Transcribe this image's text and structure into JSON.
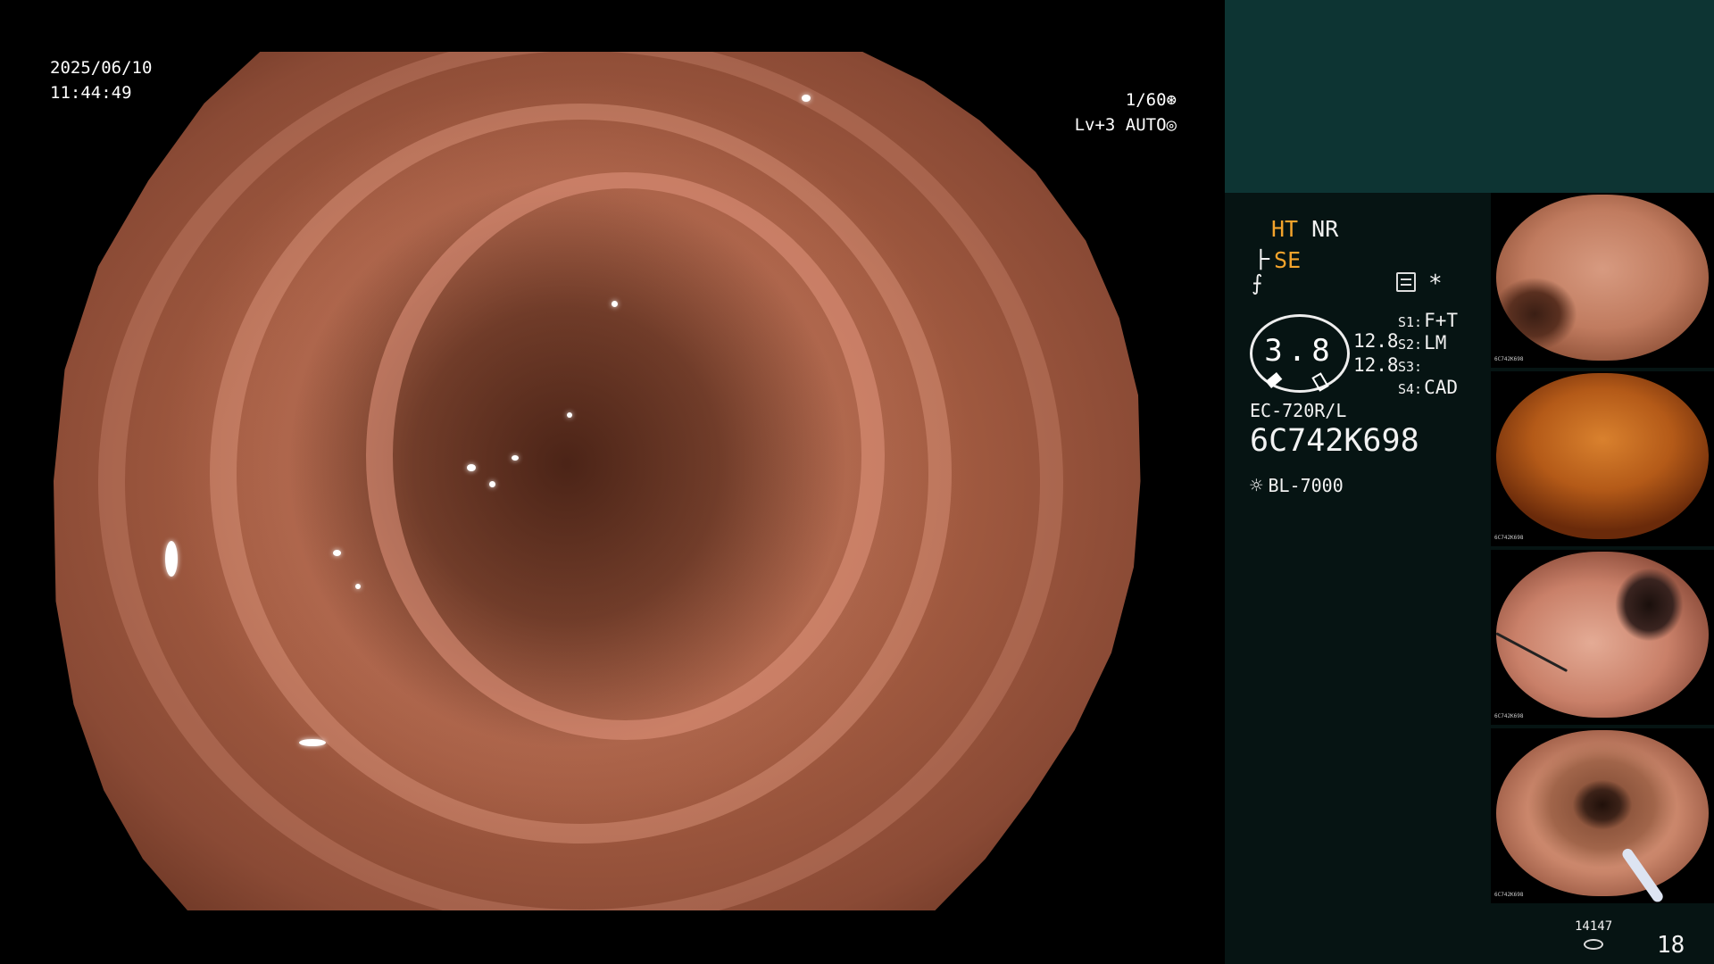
{
  "osd": {
    "date": "2025/06/10",
    "time": "11:44:49",
    "shutter": "1/60",
    "shutter_icon": "aperture-icon",
    "iris_level": "Lv+3",
    "iris_mode": "AUTO",
    "iris_icon": "iris-icon"
  },
  "panel": {
    "ht_label": "HT",
    "nr_label": "NR",
    "se_label": "SE",
    "structure_icon": "structure-enhance-icon",
    "settings_icon": "menu-icon",
    "star_label": "*",
    "gauge_value": "3.8",
    "mag_values": [
      "12.8",
      "12.8"
    ],
    "scope_switches": [
      {
        "label": "S1:",
        "value": "F+T"
      },
      {
        "label": "S2:",
        "value": "LM"
      },
      {
        "label": "S3:",
        "value": ""
      },
      {
        "label": "S4:",
        "value": "CAD"
      }
    ],
    "scope_model": "EC-720R/L",
    "scope_serial": "6C742K698",
    "light_icon": "light-source-icon",
    "light_source": "BL-7000",
    "capture_count": "14147",
    "storage_icon": "storage-icon",
    "page_number": "18"
  },
  "colors": {
    "panel_background": "#061413",
    "panel_top": "#0d3433",
    "accent_orange": "#f4a42c"
  },
  "thumbnails": [
    {
      "serial": "6C742K698"
    },
    {
      "serial": "6C742K698"
    },
    {
      "serial": "6C742K698"
    },
    {
      "serial": "6C742K698"
    }
  ]
}
